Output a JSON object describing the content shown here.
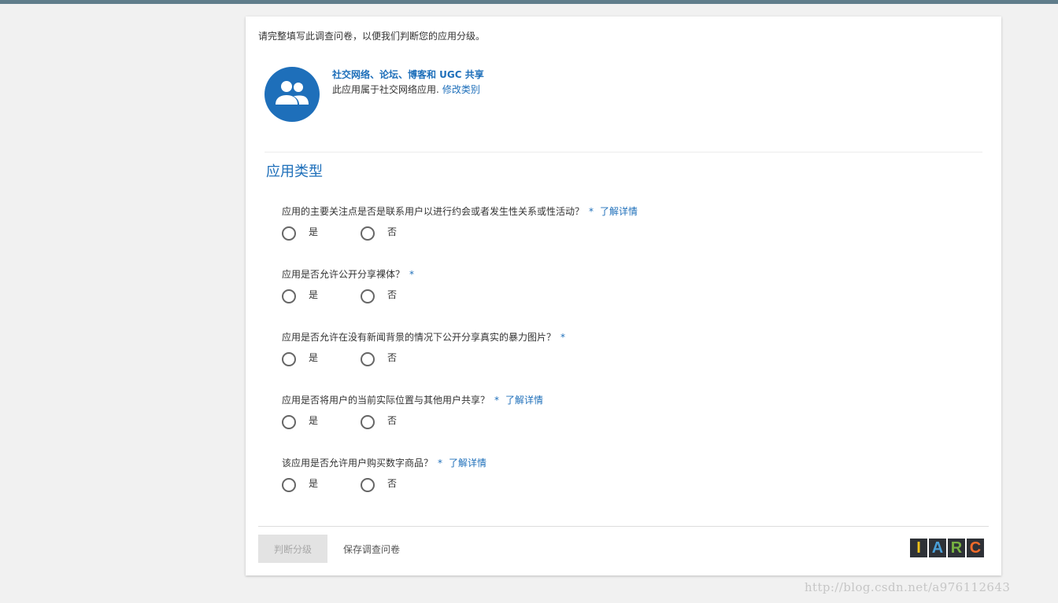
{
  "intro": "请完整填写此调查问卷，以便我们判断您的应用分级。",
  "category": {
    "icon": "people-group-icon",
    "title": "社交网络、论坛、博客和 UGC 共享",
    "description": "此应用属于社交网络应用.",
    "change_link": "修改类别"
  },
  "section_title": "应用类型",
  "questions": [
    {
      "text": "应用的主要关注点是否是联系用户以进行约会或者发生性关系或性活动？",
      "required": "*",
      "learn_more": "了解详情",
      "yes": "是",
      "no": "否"
    },
    {
      "text": "应用是否允许公开分享裸体？",
      "required": "*",
      "learn_more": "",
      "yes": "是",
      "no": "否"
    },
    {
      "text": "应用是否允许在没有新闻背景的情况下公开分享真实的暴力图片？",
      "required": "*",
      "learn_more": "",
      "yes": "是",
      "no": "否"
    },
    {
      "text": "应用是否将用户的当前实际位置与其他用户共享？",
      "required": "*",
      "learn_more": "了解详情",
      "yes": "是",
      "no": "否"
    },
    {
      "text": "该应用是否允许用户购买数字商品？",
      "required": "*",
      "learn_more": "了解详情",
      "yes": "是",
      "no": "否"
    }
  ],
  "footer": {
    "rate_button": "判断分级",
    "save_button": "保存调查问卷",
    "logo_letters": [
      "I",
      "A",
      "R",
      "C"
    ],
    "logo_colors": [
      "#f2c21b",
      "#4a9fd8",
      "#76b041",
      "#f26b2a"
    ]
  },
  "colors": {
    "accent": "#1e6fba",
    "topbar": "#607d8b"
  },
  "watermark": "http://blog.csdn.net/a976112643"
}
